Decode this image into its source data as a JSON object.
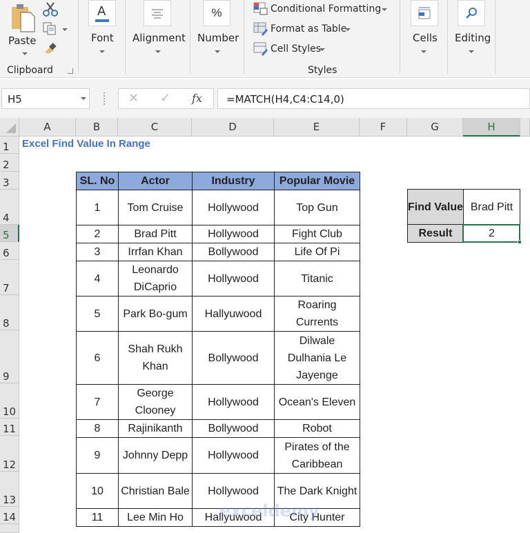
{
  "ribbon": {
    "clipboard": {
      "paste": "Paste",
      "group": "Clipboard"
    },
    "font": "Font",
    "alignment": "Alignment",
    "number": "Number",
    "number_symbol": "%",
    "styles": {
      "conditional": "Conditional Formatting",
      "format_table": "Format as Table",
      "cell_styles": "Cell Styles",
      "group": "Styles"
    },
    "cells": "Cells",
    "editing": "Editing"
  },
  "formula_bar": {
    "name_box": "H5",
    "formula": "=MATCH(H4,C4:C14,0)",
    "fx": "fx"
  },
  "columns": [
    "A",
    "B",
    "C",
    "D",
    "E",
    "F",
    "G",
    "H"
  ],
  "selected_column": "H",
  "rows": [
    "1",
    "2",
    "3",
    "4",
    "5",
    "6",
    "7",
    "8",
    "9",
    "10",
    "11",
    "12",
    "13",
    "14"
  ],
  "selected_row": "5",
  "sheet": {
    "title": "Excel Find Value In Range",
    "table": {
      "headers": [
        "SL. No",
        "Actor",
        "Industry",
        "Popular Movie"
      ],
      "rows": [
        [
          "1",
          "Tom Cruise",
          "Hollywood",
          "Top Gun"
        ],
        [
          "2",
          "Brad Pitt",
          "Hollywood",
          "Fight Club"
        ],
        [
          "3",
          "Irrfan Khan",
          "Bollywood",
          "Life Of Pi"
        ],
        [
          "4",
          "Leonardo DiCaprio",
          "Hollywood",
          "Titanic"
        ],
        [
          "5",
          "Park Bo-gum",
          "Hallyuwood",
          "Roaring Currents"
        ],
        [
          "6",
          "Shah Rukh Khan",
          "Bollywood",
          "Dilwale Dulhania Le Jayenge"
        ],
        [
          "7",
          "George Clooney",
          "Hollywood",
          "Ocean's Eleven"
        ],
        [
          "8",
          "Rajinikanth",
          "Bollywood",
          "Robot"
        ],
        [
          "9",
          "Johnny Depp",
          "Hollywood",
          "Pirates of the Caribbean"
        ],
        [
          "10",
          "Christian Bale",
          "Hollywood",
          "The Dark Knight"
        ],
        [
          "11",
          "Lee Min Ho",
          "Hallyuwood",
          "City Hunter"
        ]
      ]
    },
    "lookup": {
      "find_label": "Find Value",
      "find_value": "Brad Pitt",
      "result_label": "Result",
      "result_value": "2"
    }
  },
  "watermark": "exceldemy",
  "colors": {
    "header_fill": "#8ea9db",
    "label_fill": "#d9d9d9",
    "title": "#4472c4",
    "selection": "#217346"
  }
}
